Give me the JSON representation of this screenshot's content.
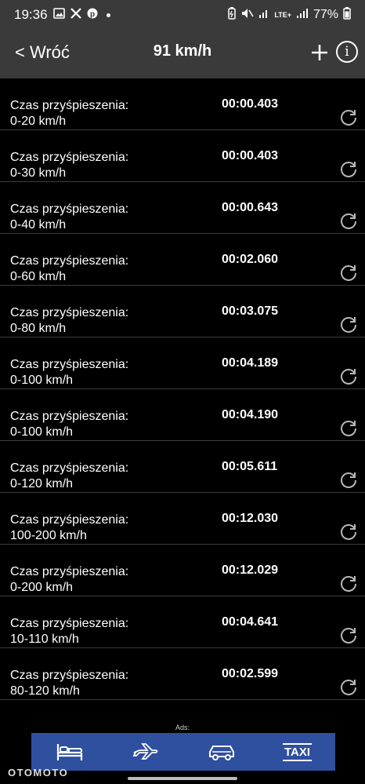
{
  "status_bar": {
    "time": "19:36",
    "battery": "77%",
    "network": "LTE+"
  },
  "header": {
    "back_label": "< Wróć",
    "title": "91 km/h"
  },
  "rows": [
    {
      "label_line1": "Czas przyśpieszenia:",
      "label_line2": "0-20 km/h",
      "time": "00:00.403"
    },
    {
      "label_line1": "Czas przyśpieszenia:",
      "label_line2": "0-30 km/h",
      "time": "00:00.403"
    },
    {
      "label_line1": "Czas przyśpieszenia:",
      "label_line2": "0-40 km/h",
      "time": "00:00.643"
    },
    {
      "label_line1": "Czas przyśpieszenia:",
      "label_line2": "0-60 km/h",
      "time": "00:02.060"
    },
    {
      "label_line1": "Czas przyśpieszenia:",
      "label_line2": "0-80 km/h",
      "time": "00:03.075"
    },
    {
      "label_line1": "Czas przyśpieszenia:",
      "label_line2": "0-100 km/h",
      "time": "00:04.189"
    },
    {
      "label_line1": "Czas przyśpieszenia:",
      "label_line2": "0-100 km/h",
      "time": "00:04.190"
    },
    {
      "label_line1": "Czas przyśpieszenia:",
      "label_line2": "0-120 km/h",
      "time": "00:05.611"
    },
    {
      "label_line1": "Czas przyśpieszenia:",
      "label_line2": "100-200 km/h",
      "time": "00:12.030"
    },
    {
      "label_line1": "Czas przyśpieszenia:",
      "label_line2": "0-200 km/h",
      "time": "00:12.029"
    },
    {
      "label_line1": "Czas przyśpieszenia:",
      "label_line2": "10-110 km/h",
      "time": "00:04.641"
    },
    {
      "label_line1": "Czas przyśpieszenia:",
      "label_line2": "80-120 km/h",
      "time": "00:02.599"
    }
  ],
  "ads": {
    "label": "Ads:",
    "taxi_label": "TAXI",
    "icons": [
      "bed-icon",
      "airplane-icon",
      "car-icon",
      "taxi-icon"
    ]
  },
  "watermark": "OTOMOTO",
  "colors": {
    "bar_background": "#3a3a3a",
    "ad_background": "#2f4f9f",
    "row_divider": "#3c3c3c"
  }
}
